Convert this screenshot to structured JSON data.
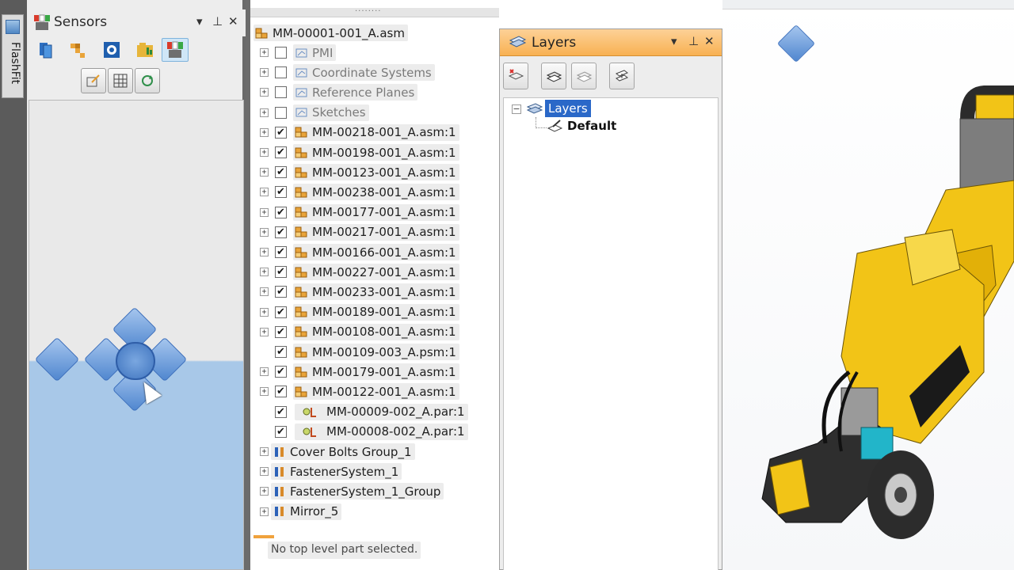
{
  "flashfit": {
    "label": "FlashFit"
  },
  "sensors": {
    "title": "Sensors",
    "controls": {
      "dropdown": "▾",
      "pin": "⊥",
      "close": "✕"
    }
  },
  "tree": {
    "root": "MM-00001-001_A.asm",
    "rows": [
      {
        "label": "PMI",
        "muted": true,
        "expander": true,
        "checked": false
      },
      {
        "label": "Coordinate Systems",
        "muted": true,
        "expander": true,
        "checked": false
      },
      {
        "label": "Reference Planes",
        "muted": true,
        "expander": true,
        "checked": false
      },
      {
        "label": "Sketches",
        "muted": true,
        "expander": true,
        "checked": false
      },
      {
        "label": "MM-00218-001_A.asm:1",
        "expander": true,
        "checked": true
      },
      {
        "label": "MM-00198-001_A.asm:1",
        "expander": true,
        "checked": true
      },
      {
        "label": "MM-00123-001_A.asm:1",
        "expander": true,
        "checked": true
      },
      {
        "label": "MM-00238-001_A.asm:1",
        "expander": true,
        "checked": true
      },
      {
        "label": "MM-00177-001_A.asm:1",
        "expander": true,
        "checked": true
      },
      {
        "label": "MM-00217-001_A.asm:1",
        "expander": true,
        "checked": true
      },
      {
        "label": "MM-00166-001_A.asm:1",
        "expander": true,
        "checked": true
      },
      {
        "label": "MM-00227-001_A.asm:1",
        "expander": true,
        "checked": true
      },
      {
        "label": "MM-00233-001_A.asm:1",
        "expander": true,
        "checked": true
      },
      {
        "label": "MM-00189-001_A.asm:1",
        "expander": true,
        "checked": true
      },
      {
        "label": "MM-00108-001_A.asm:1",
        "expander": true,
        "checked": true
      },
      {
        "label": "MM-00109-003_A.psm:1",
        "expander": false,
        "checked": true
      },
      {
        "label": "MM-00179-001_A.asm:1",
        "expander": true,
        "checked": true
      },
      {
        "label": "MM-00122-001_A.asm:1",
        "expander": true,
        "checked": true
      },
      {
        "label": "MM-00009-002_A.par:1",
        "expander": false,
        "checked": true,
        "part": true
      },
      {
        "label": "MM-00008-002_A.par:1",
        "expander": false,
        "checked": true,
        "part": true
      },
      {
        "label": "Cover Bolts Group_1",
        "expander": true,
        "nocheck": true
      },
      {
        "label": "FastenerSystem_1",
        "expander": true,
        "nocheck": true
      },
      {
        "label": "FastenerSystem_1_Group",
        "expander": true,
        "nocheck": true
      },
      {
        "label": "Mirror_5",
        "expander": true,
        "nocheck": true
      }
    ],
    "status": "No top level part selected."
  },
  "layers": {
    "title": "Layers",
    "controls": {
      "dropdown": "▾",
      "pin": "⊥",
      "close": "✕"
    },
    "root": "Layers",
    "default": "Default"
  },
  "colors": {
    "layersHeader": "#f8b152",
    "selection": "#2a68c8",
    "dockBlue": "#4f86cf",
    "modelYellow": "#f2c417"
  },
  "icons": {
    "sensors": "sensors-icon",
    "layers": "layers-icon",
    "flashfit": "flashfit-icon"
  }
}
